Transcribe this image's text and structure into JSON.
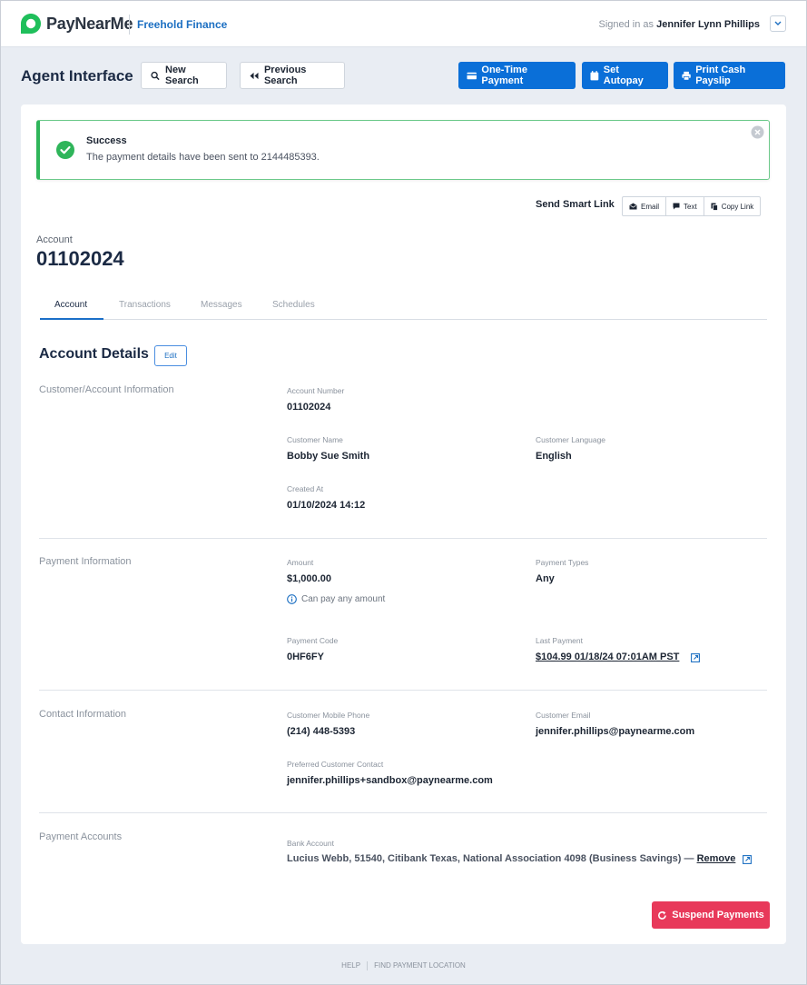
{
  "header": {
    "brand": "PayNearMe",
    "merchant": "Freehold Finance",
    "signed_in_prefix": "Signed in as",
    "user_name": "Jennifer Lynn Phillips"
  },
  "toolbar": {
    "title": "Agent Interface",
    "new_search": "New Search",
    "previous_search": "Previous Search",
    "one_time_payment": "One-Time Payment",
    "set_autopay": "Set Autopay",
    "print_cash_payslip": "Print Cash Payslip"
  },
  "alert": {
    "title": "Success",
    "message": "The payment details have been sent to 2144485393."
  },
  "smart_link": {
    "label": "Send Smart Link",
    "email": "Email",
    "text": "Text",
    "copy": "Copy Link"
  },
  "account": {
    "label": "Account",
    "number": "01102024"
  },
  "tabs": [
    "Account",
    "Transactions",
    "Messages",
    "Schedules"
  ],
  "details": {
    "title": "Account Details",
    "edit": "Edit"
  },
  "sections": {
    "customer": {
      "label": "Customer/Account Information",
      "account_number_label": "Account Number",
      "account_number": "01102024",
      "customer_name_label": "Customer Name",
      "customer_name": "Bobby Sue Smith",
      "language_label": "Customer Language",
      "language": "English",
      "created_label": "Created At",
      "created": "01/10/2024 14:12"
    },
    "payment": {
      "label": "Payment Information",
      "amount_label": "Amount",
      "amount": "$1,000.00",
      "amount_note": "Can pay any amount",
      "types_label": "Payment Types",
      "types": "Any",
      "code_label": "Payment Code",
      "code": "0HF6FY",
      "last_label": "Last Payment",
      "last": "$104.99 01/18/24 07:01AM PST"
    },
    "contact": {
      "label": "Contact Information",
      "mobile_label": "Customer Mobile Phone",
      "mobile": "(214) 448-5393",
      "email_label": "Customer Email",
      "email": "jennifer.phillips@paynearme.com",
      "preferred_label": "Preferred Customer Contact",
      "preferred": "jennifer.phillips+sandbox@paynearme.com"
    },
    "payment_accounts": {
      "label": "Payment Accounts",
      "bank_label": "Bank Account",
      "bank": "Lucius Webb, 51540, Citibank Texas, National Association 4098 (Business Savings) —",
      "remove": "Remove"
    }
  },
  "actions": {
    "suspend": "Suspend Payments"
  },
  "footer": {
    "help": "HELP",
    "find": "FIND PAYMENT LOCATION"
  },
  "colors": {
    "primary": "#0a6fd8",
    "success": "#2fb55a",
    "danger": "#e8395a",
    "brand_green": "#1fbf5b"
  }
}
